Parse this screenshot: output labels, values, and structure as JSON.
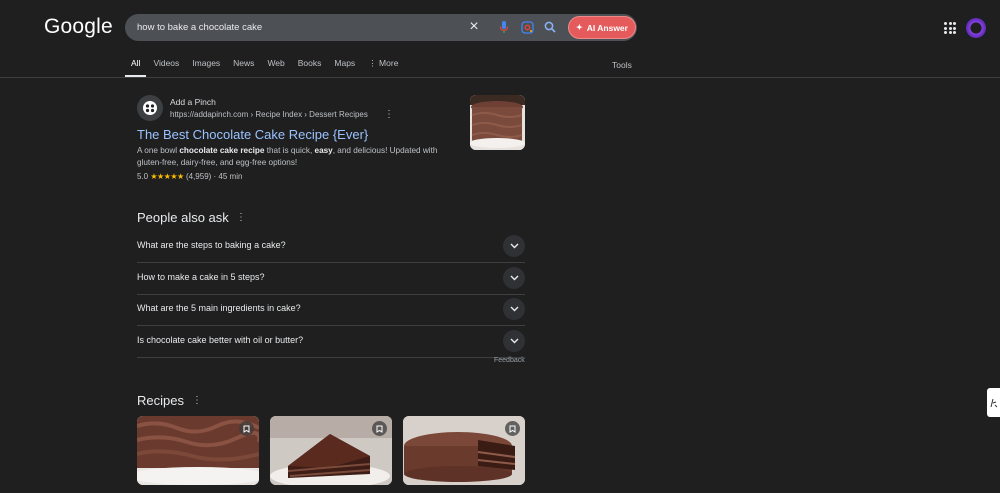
{
  "header": {
    "logo": "Google",
    "search_value": "how to bake a chocolate cake",
    "ai_answer_label": "AI Answer"
  },
  "tabs": [
    {
      "label": "All"
    },
    {
      "label": "Videos"
    },
    {
      "label": "Images"
    },
    {
      "label": "News"
    },
    {
      "label": "Web"
    },
    {
      "label": "Books"
    },
    {
      "label": "Maps"
    },
    {
      "label": "⋮ More"
    }
  ],
  "tools_label": "Tools",
  "result": {
    "site_name": "Add a Pinch",
    "url": "https://addapinch.com › Recipe Index › Dessert Recipes",
    "title": "The Best Chocolate Cake Recipe {Ever}",
    "snippet_1": "A one bowl ",
    "snippet_bold_1": "chocolate cake recipe",
    "snippet_2": " that is quick, ",
    "snippet_bold_2": "easy",
    "snippet_3": ", and delicious! Updated with gluten-free, dairy-free, and egg-free options!",
    "rating_value": "5.0",
    "stars": "★★★★★",
    "rating_meta": "(4,959) · 45 min"
  },
  "paa": {
    "title": "People also ask",
    "questions": [
      "What are the steps to baking a cake?",
      "How to make a cake in 5 steps?",
      "What are the 5 main ingredients in cake?",
      "Is chocolate cake better with oil or butter?"
    ],
    "feedback": "Feedback"
  },
  "recipes": {
    "title": "Recipes"
  },
  "colors": {
    "background": "#1f1f1f",
    "link": "#99c3ff",
    "ai_button": "#e55b5b",
    "star": "#fbbc04"
  }
}
